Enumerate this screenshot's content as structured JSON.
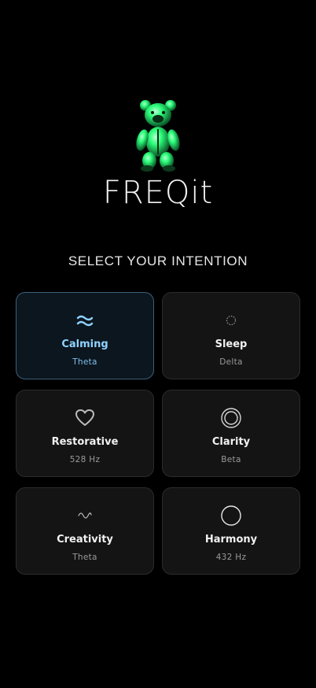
{
  "app": {
    "title": "FREQit",
    "logo_icon": "neon-teddy-bear-logo",
    "accent_color": "#2bff7a"
  },
  "intentions": {
    "heading": "SELECT YOUR INTENTION",
    "selected_color": "#8fd3ff",
    "items": [
      {
        "label": "Calming",
        "sub": "Theta",
        "icon": "waves-icon",
        "selected": true
      },
      {
        "label": "Sleep",
        "sub": "Delta",
        "icon": "dotted-circle-icon",
        "selected": false
      },
      {
        "label": "Restorative",
        "sub": "528 Hz",
        "icon": "heart-icon",
        "selected": false
      },
      {
        "label": "Clarity",
        "sub": "Beta",
        "icon": "double-circle-icon",
        "selected": false
      },
      {
        "label": "Creativity",
        "sub": "Theta",
        "icon": "sine-wave-icon",
        "selected": false
      },
      {
        "label": "Harmony",
        "sub": "432 Hz",
        "icon": "circle-icon",
        "selected": false
      }
    ]
  }
}
